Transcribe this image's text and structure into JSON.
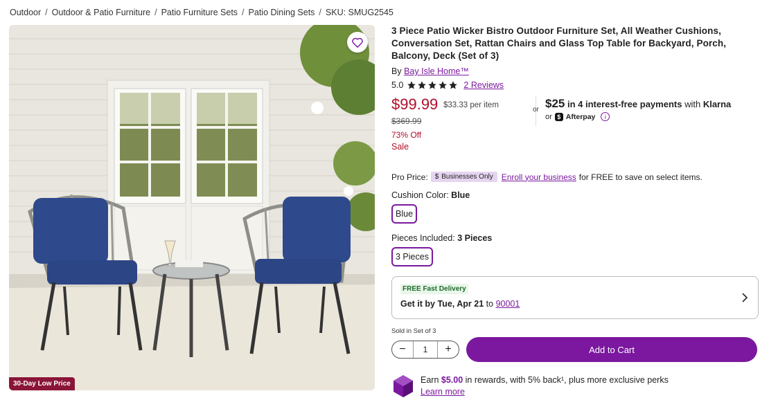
{
  "breadcrumb": {
    "items": [
      "Outdoor",
      "Outdoor & Patio Furniture",
      "Patio Furniture Sets",
      "Patio Dining Sets"
    ],
    "sku": "SKU: SMUG2545",
    "separator": "/"
  },
  "image": {
    "badge": "30-Day Low Price",
    "favorite_icon": "heart-icon"
  },
  "product": {
    "title": "3 Piece Patio Wicker Bistro Outdoor Furniture Set, All Weather Cushions, Conversation Set, Rattan Chairs and Glass Top Table for Backyard, Porch, Balcony, Deck (Set of 3)",
    "by_prefix": "By",
    "brand": "Bay Isle Home™",
    "rating_value": "5.0",
    "stars": 5,
    "reviews_link": "2 Reviews"
  },
  "pricing": {
    "price": "$99.99",
    "per_item": "$33.33 per item",
    "was_price": "$369.99",
    "discount": "73% Off",
    "sale_label": "Sale",
    "or_label": "or",
    "klarna_amount": "$25",
    "klarna_text": "in 4 interest-free payments",
    "klarna_with": "with",
    "klarna_brand": "Klarna",
    "or_afterpay": "or",
    "afterpay_brand": "Afterpay"
  },
  "pro_price": {
    "label": "Pro Price:",
    "tag": "Businesses Only",
    "enroll_link": "Enroll your business",
    "suffix": "for FREE to save on select items."
  },
  "options": {
    "cushion_label": "Cushion Color:",
    "cushion_value": "Blue",
    "cushion_option": "Blue",
    "pieces_label": "Pieces Included:",
    "pieces_value": "3 Pieces",
    "pieces_option": "3 Pieces"
  },
  "delivery": {
    "badge": "FREE Fast Delivery",
    "get_it": "Get it by Tue, Apr 21",
    "to": "to",
    "zip": "90001"
  },
  "cart": {
    "sold_in": "Sold in Set of 3",
    "quantity": "1",
    "minus": "−",
    "plus": "+",
    "add_to_cart": "Add to Cart"
  },
  "rewards": {
    "earn_prefix": "Earn",
    "amount": "$5.00",
    "earn_suffix": "in rewards, with 5% back¹, plus more exclusive perks",
    "learn_more": "Learn more"
  },
  "colors": {
    "accent": "#7b189f",
    "price_red": "#b00e2a",
    "badge_bg": "#8a1538"
  }
}
